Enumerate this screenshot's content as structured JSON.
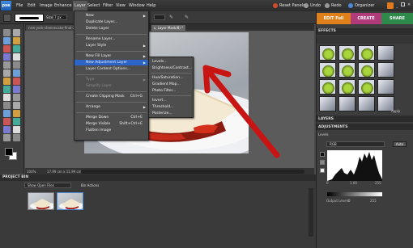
{
  "app": {
    "logo": "pse"
  },
  "menubar": {
    "items": [
      "File",
      "Edit",
      "Image",
      "Enhance",
      "Layer",
      "Select",
      "Filter",
      "View",
      "Window",
      "Help"
    ],
    "right_buttons": [
      "Reset Panels",
      "Undo",
      "Redo",
      "Organizer"
    ]
  },
  "options": {
    "size_label": "Size:",
    "size_value": "7 px"
  },
  "document": {
    "tabs": [
      "new-york-cheesecake-final-2 @...",
      "s, Layer Mask/8) *"
    ],
    "zoom": "100%",
    "status": "17.99 cm x 11.99 cm (72 ppi)"
  },
  "layer_menu": {
    "items": [
      {
        "label": "New",
        "arrow": "▶"
      },
      {
        "label": "Duplicate Layer..."
      },
      {
        "label": "Delete Layer"
      },
      {
        "label": "Rename Layer..."
      },
      {
        "label": "Layer Style",
        "arrow": "▶"
      },
      {
        "label": "New Fill Layer",
        "arrow": "▶"
      },
      {
        "label": "New Adjustment Layer",
        "arrow": "▶"
      },
      {
        "label": "Layer Content Options..."
      },
      {
        "label": "Type",
        "arrow": "▶"
      },
      {
        "label": "Simplify Layer"
      },
      {
        "label": "Create Clipping Mask",
        "shortcut": "Ctrl+G"
      },
      {
        "label": "Arrange",
        "arrow": "▶"
      },
      {
        "label": "Merge Down",
        "shortcut": "Ctrl+E"
      },
      {
        "label": "Merge Visible",
        "shortcut": "Shift+Ctrl+E"
      },
      {
        "label": "Flatten Image"
      }
    ]
  },
  "adjustment_submenu": {
    "items": [
      "Levels...",
      "Brightness/Contrast...",
      "Hue/Saturation...",
      "Gradient Map...",
      "Photo Filter...",
      "Invert...",
      "Threshold...",
      "Posterize..."
    ]
  },
  "right_panel": {
    "tabs": [
      "EDIT Full",
      "CREATE",
      "SHARE"
    ],
    "effects_title": "EFFECTS",
    "effects_footer": "Apply",
    "layers_title": "LAYERS",
    "adjustments_title": "ADJUSTMENTS",
    "levels_label": "Levels",
    "channel": "RGB",
    "auto_button": "Auto",
    "input_values": [
      "0",
      "1.00",
      "255"
    ],
    "output_label": "Output Levels:",
    "output_values": [
      "0",
      "255"
    ]
  },
  "project_bin": {
    "title": "PROJECT BIN",
    "dropdown": "Show Open Files",
    "bin_actions": "Bin Actions"
  },
  "colors": {
    "edit_tab": "#e0801a",
    "create_tab": "#b03a7a",
    "share_tab": "#2e8a4a",
    "menu_highlight": "#2c64c8",
    "arrow_red": "#c91414"
  },
  "icons": [
    "magnifier-icon",
    "hand-icon",
    "eyedropper-icon",
    "brush-icon",
    "eraser-icon",
    "paint-bucket-icon",
    "crop-icon",
    "text-icon",
    "shape-icon",
    "arrow-annotation"
  ]
}
